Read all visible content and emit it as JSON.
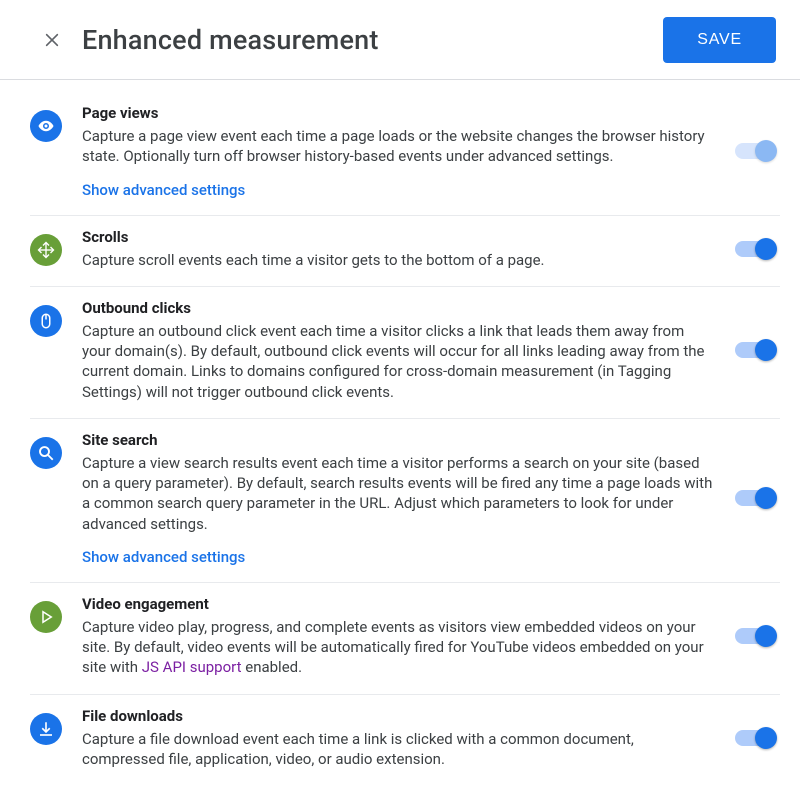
{
  "header": {
    "title": "Enhanced measurement",
    "save": "SAVE"
  },
  "items": [
    {
      "icon": "eye",
      "bubbleClass": "blue-bub",
      "title": "Page views",
      "desc": "Capture a page view event each time a page loads or the website changes the browser history state. Optionally turn off browser history-based events under advanced settings.",
      "adv": "Show advanced settings",
      "toggle": true,
      "locked": true
    },
    {
      "icon": "scroll",
      "bubbleClass": "green-bub",
      "title": "Scrolls",
      "desc": "Capture scroll events each time a visitor gets to the bottom of a page.",
      "toggle": true
    },
    {
      "icon": "mouse",
      "bubbleClass": "blue-bub",
      "title": "Outbound clicks",
      "desc": "Capture an outbound click event each time a visitor clicks a link that leads them away from your domain(s). By default, outbound click events will occur for all links leading away from the current domain. Links to domains configured for cross-domain measurement (in Tagging Settings) will not trigger outbound click events.",
      "toggle": true
    },
    {
      "icon": "search",
      "bubbleClass": "blue-bub",
      "title": "Site search",
      "desc": "Capture a view search results event each time a visitor performs a search on your site (based on a query parameter). By default, search results events will be fired any time a page loads with a common search query parameter in the URL. Adjust which parameters to look for under advanced settings.",
      "adv": "Show advanced settings",
      "toggle": true
    },
    {
      "icon": "play",
      "bubbleClass": "green-bub",
      "title": "Video engagement",
      "desc": "Capture video play, progress, and complete events as visitors view embedded videos on your site. By default, video events will be automatically fired for YouTube videos embedded on your site with ",
      "descLinkText": "JS API support",
      "descTail": " enabled.",
      "toggle": true
    },
    {
      "icon": "download",
      "bubbleClass": "blue-bub",
      "title": "File downloads",
      "desc": "Capture a file download event each time a link is clicked with a common document, compressed file, application, video, or audio extension.",
      "toggle": true
    }
  ]
}
